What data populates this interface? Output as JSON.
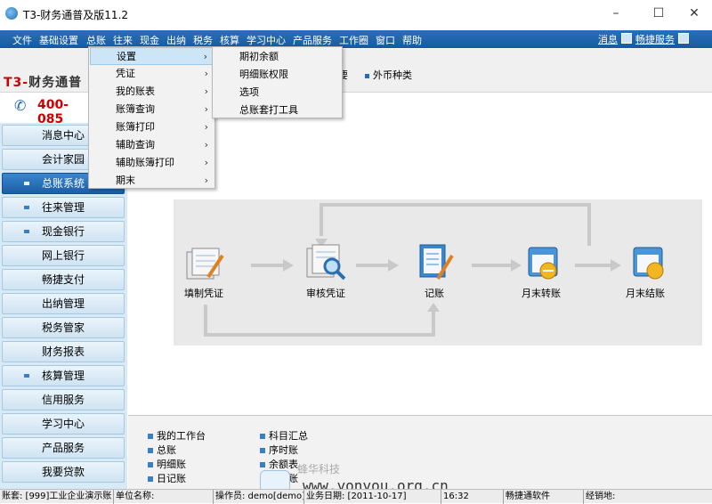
{
  "window": {
    "title": "T3-财务通普及版11.2",
    "minimize": "–",
    "maximize": "☐",
    "close": "✕"
  },
  "menubar": {
    "items": [
      "文件",
      "基础设置",
      "总账",
      "往来",
      "现金",
      "出纳",
      "税务",
      "核算",
      "学习中心",
      "产品服务",
      "工作圈",
      "窗口",
      "帮助"
    ],
    "right": [
      "消息",
      "畅捷服务"
    ]
  },
  "toolbar": {
    "items": [
      "要",
      "外币种类"
    ]
  },
  "brand": {
    "logo_prefix": "T3-",
    "logo_rest": "财务通普",
    "phone": "400-085"
  },
  "sidebar": {
    "items": [
      "消息中心",
      "会计家园",
      "总账系统",
      "往来管理",
      "现金银行",
      "网上银行",
      "畅捷支付",
      "出纳管理",
      "税务管家",
      "财务报表",
      "核算管理",
      "信用服务",
      "学习中心",
      "产品服务",
      "我要贷款"
    ]
  },
  "dropdown": {
    "items": [
      "设置",
      "凭证",
      "我的账表",
      "账簿查询",
      "账簿打印",
      "辅助查询",
      "辅助账簿打印",
      "期末"
    ],
    "arrow": "›"
  },
  "submenu": {
    "items": [
      "期初余额",
      "明细账权限",
      "选项",
      "总账套打工具"
    ]
  },
  "flow": {
    "steps": [
      "填制凭证",
      "审核凭证",
      "记账",
      "月末转账",
      "月末结账"
    ]
  },
  "bottom": {
    "left": [
      "我的工作台",
      "总账",
      "明细账",
      "日记账"
    ],
    "right": [
      "科目汇总",
      "序时账",
      "余额表",
      "多栏账"
    ]
  },
  "statusbar": [
    "账套: [999]工业企业演示账",
    "单位名称:",
    "操作员: demo[demo]",
    "业务日期: [2011-10-17]",
    "16:32",
    "畅捷通软件",
    "经销地:"
  ],
  "watermark": {
    "url": "www.yonyou.org.cn",
    "cn": "蜂华科技"
  },
  "colors": {
    "menubar": "#1f66b0",
    "sidebar_active": "#2a75c1",
    "sidebar_bg": "#d7eaf7"
  }
}
